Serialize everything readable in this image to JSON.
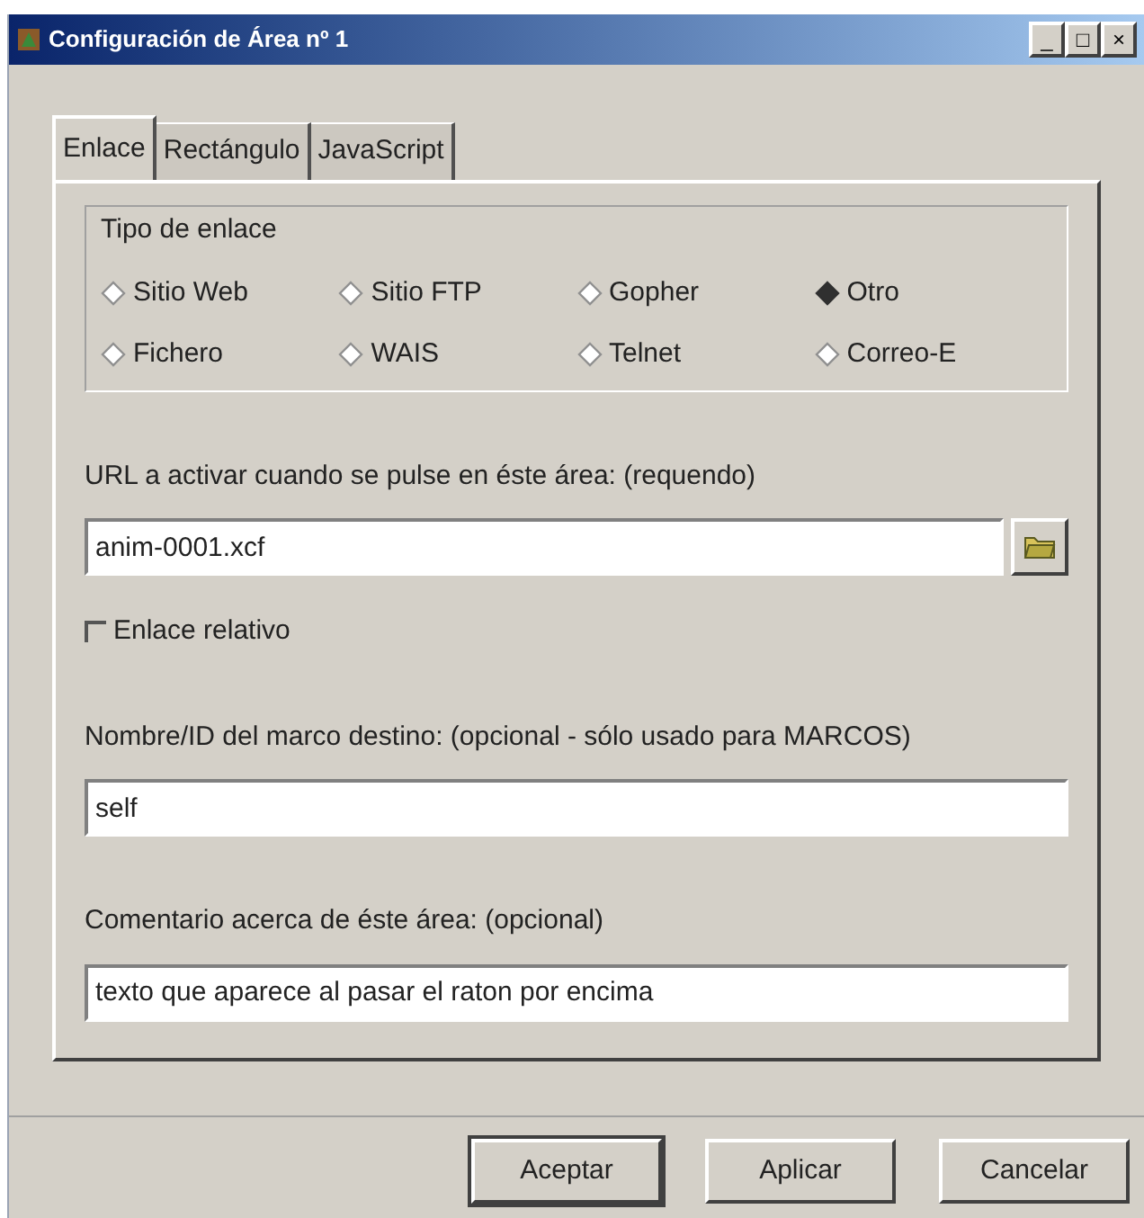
{
  "window": {
    "title": "Configuración de Área nº 1",
    "controls": [
      "_",
      "□",
      "×"
    ]
  },
  "tabs": [
    {
      "label": "Enlace",
      "selected": true
    },
    {
      "label": "Rectángulo",
      "selected": false
    },
    {
      "label": "JavaScript",
      "selected": false
    }
  ],
  "link_type": {
    "title": "Tipo de enlace",
    "options": [
      {
        "label": "Sitio Web",
        "selected": false
      },
      {
        "label": "Sitio FTP",
        "selected": false
      },
      {
        "label": "Gopher",
        "selected": false
      },
      {
        "label": "Otro",
        "selected": true
      },
      {
        "label": "Fichero",
        "selected": false
      },
      {
        "label": "WAIS",
        "selected": false
      },
      {
        "label": "Telnet",
        "selected": false
      },
      {
        "label": "Correo-E",
        "selected": false
      }
    ]
  },
  "url": {
    "label": "URL a activar cuando se pulse en éste área: (requendo)",
    "value": "anim-0001.xcf"
  },
  "relative_link": {
    "label": "Enlace relativo",
    "checked": false
  },
  "target": {
    "label": "Nombre/ID del marco destino: (opcional - sólo usado para MARCOS)",
    "value": "self"
  },
  "comment": {
    "label": "Comentario acerca de éste área: (opcional)",
    "value": "texto que aparece al pasar el raton por encima"
  },
  "buttons": [
    {
      "label": "Aceptar",
      "default": true
    },
    {
      "label": "Aplicar",
      "default": false
    },
    {
      "label": "Cancelar",
      "default": false
    }
  ]
}
